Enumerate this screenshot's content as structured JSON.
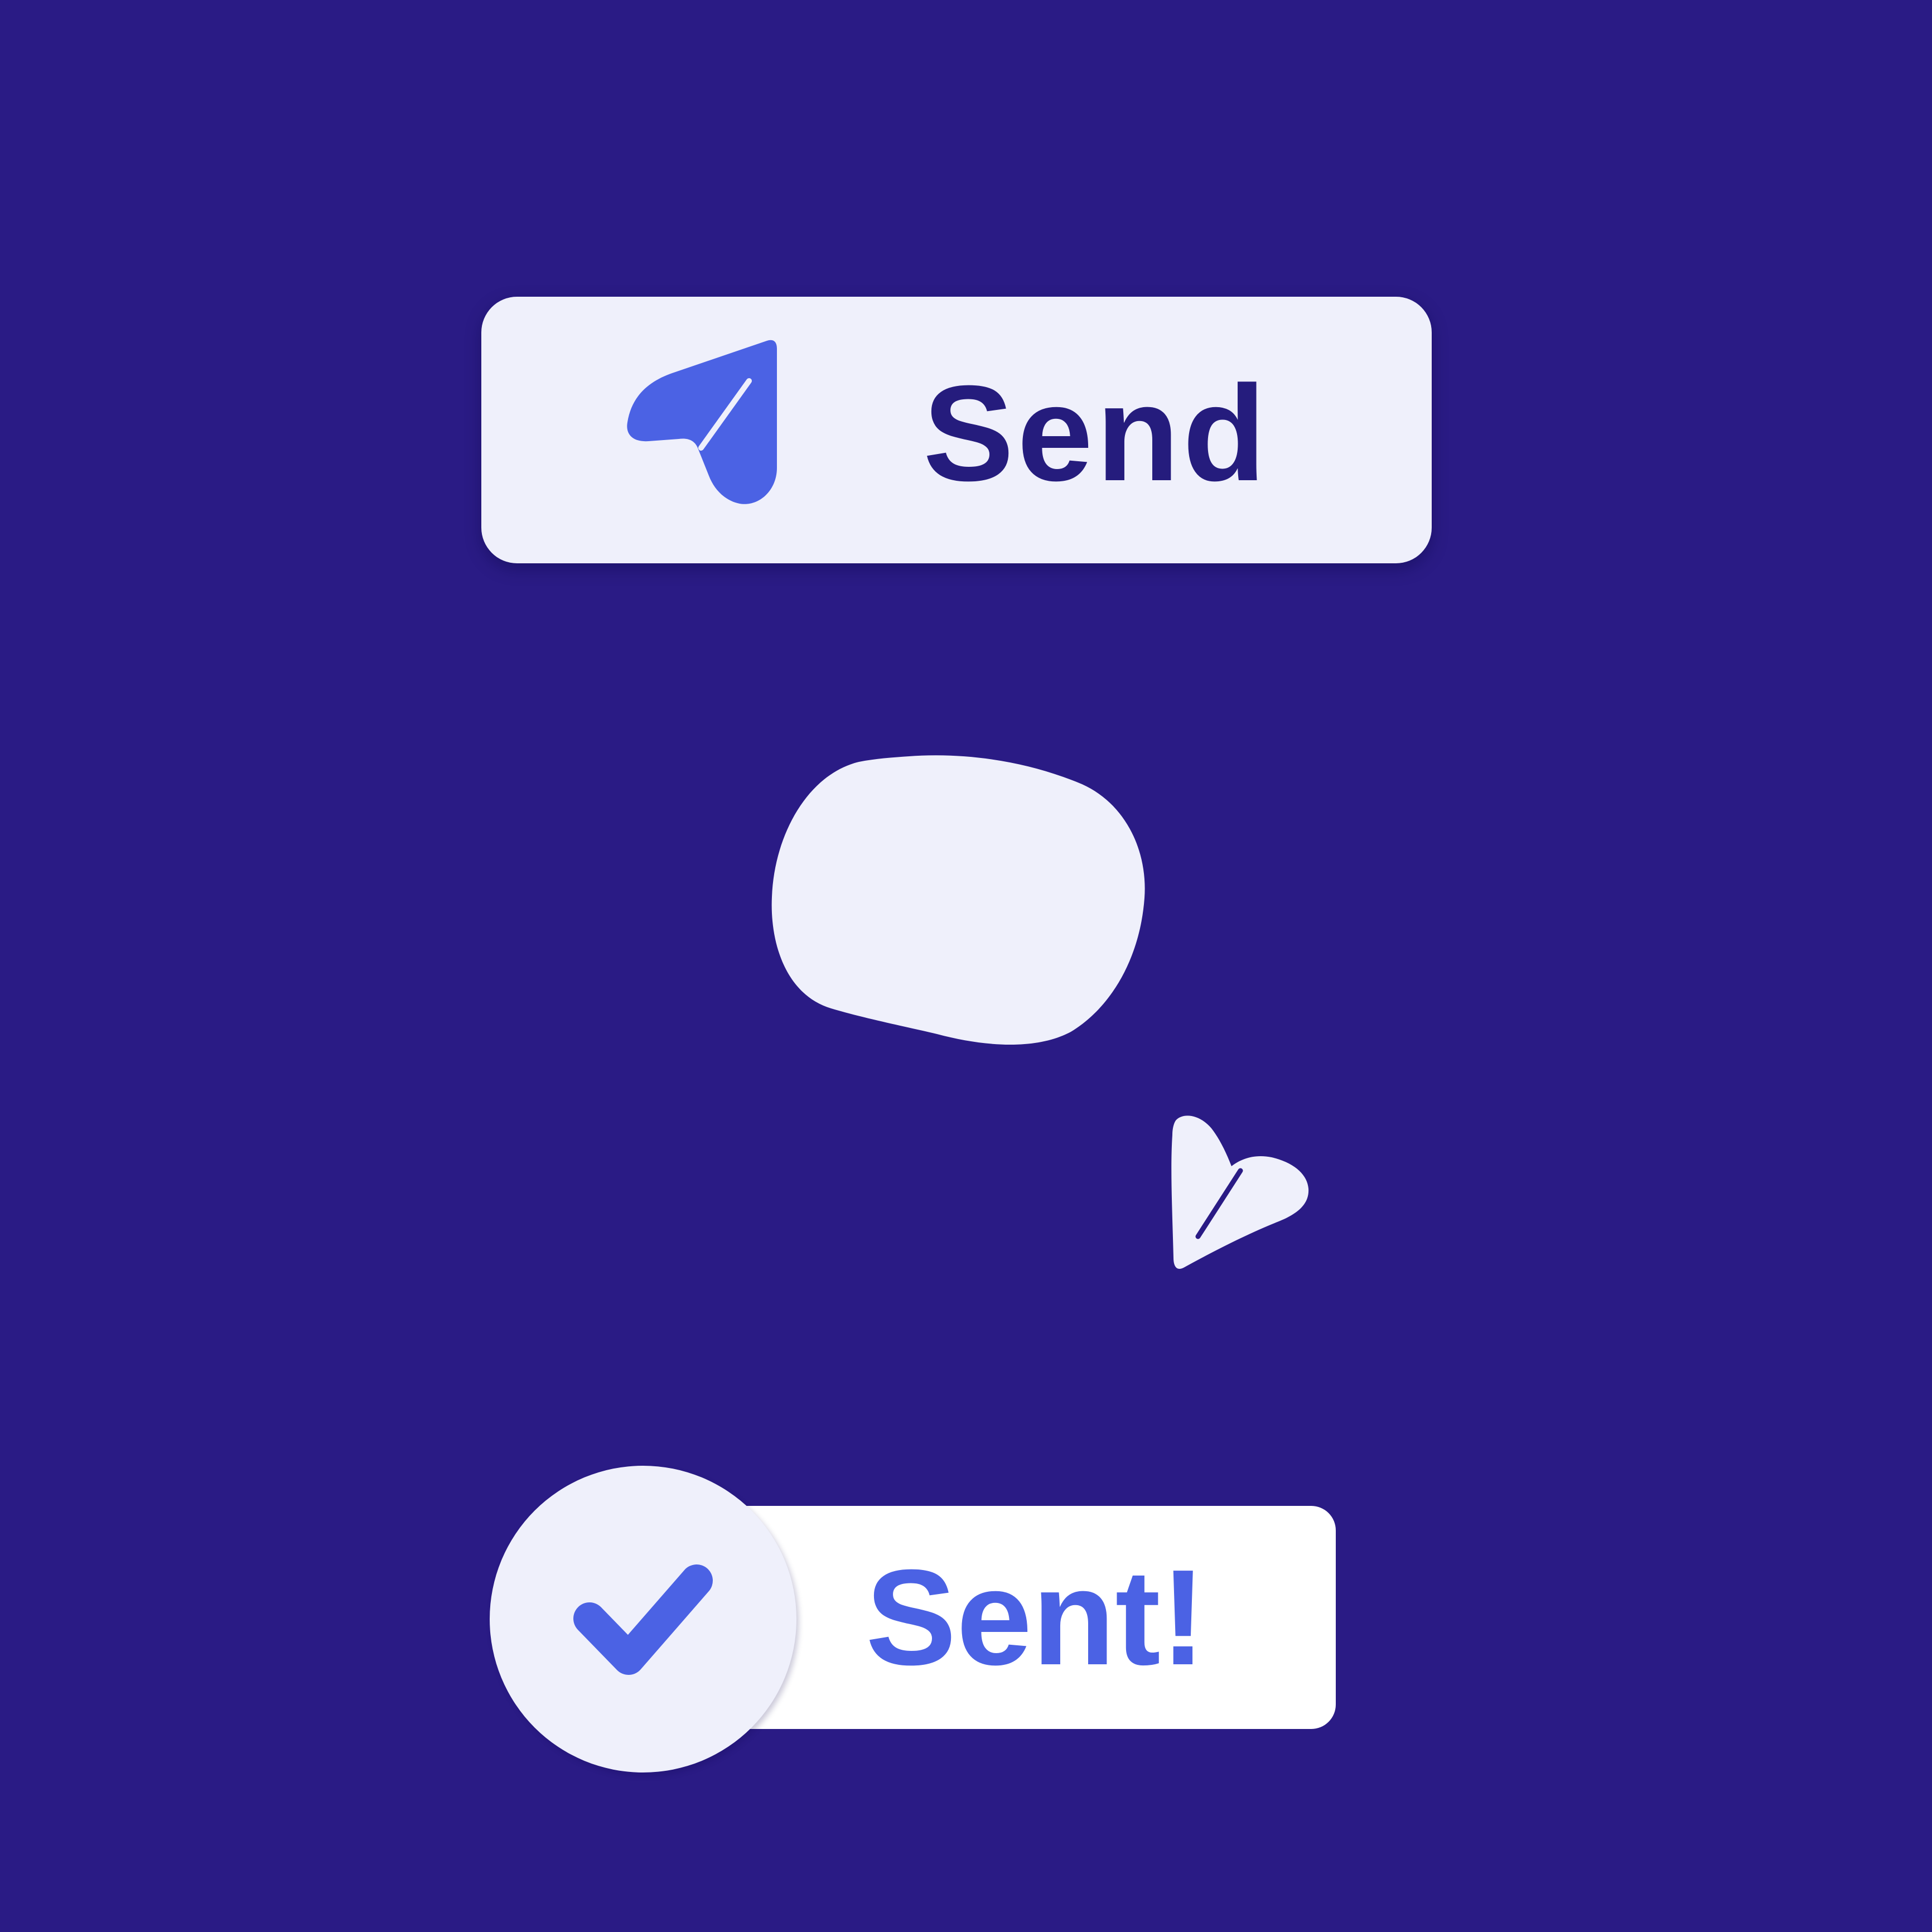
{
  "send_button": {
    "label": "Send",
    "icon": "paper-plane-icon"
  },
  "transition": {
    "blob": "morph-blob",
    "flying_icon": "paper-plane-icon"
  },
  "sent_status": {
    "label": "Sent!",
    "icon": "checkmark-icon"
  },
  "colors": {
    "background": "#2a1b85",
    "surface": "#eff0fb",
    "pill": "#ffffff",
    "accent": "#4b62e4",
    "text_dark": "#251c7d"
  }
}
